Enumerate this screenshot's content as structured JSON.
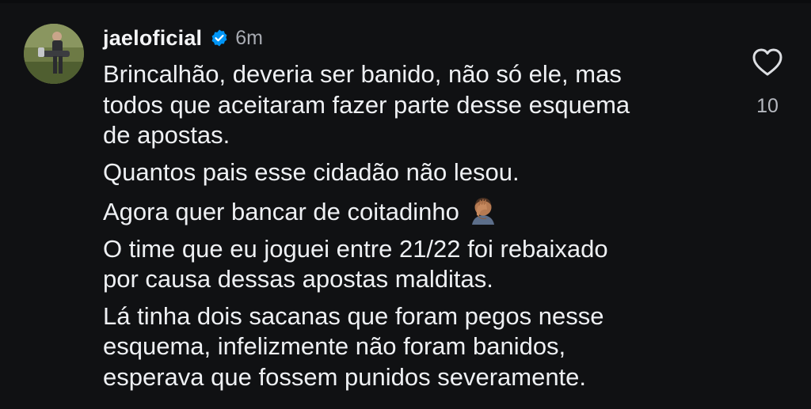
{
  "comment": {
    "username": "jaeloficial",
    "verified_icon": "verified-badge-icon",
    "timestamp": "6m",
    "paragraphs": [
      {
        "lines": [
          "Brincalhão, deveria ser banido, não só ele, mas",
          "todos que aceitaram fazer parte desse esquema",
          "de apostas."
        ]
      },
      {
        "lines": [
          "Quantos pais esse cidadão não lesou."
        ]
      },
      {
        "lines": [
          "Agora quer bancar de coitadinho"
        ],
        "emoji": "facepalm-emoji"
      },
      {
        "lines": [
          "O time que eu joguei entre 21/22 foi rebaixado",
          "por causa dessas apostas malditas."
        ]
      },
      {
        "lines": [
          "Lá tinha dois sacanas que foram pegos nesse",
          "esquema, infelizmente não foram banidos,",
          "esperava que fossem punidos severamente."
        ]
      }
    ],
    "like_icon": "heart-icon",
    "like_count": "10"
  },
  "colors": {
    "background": "#101113",
    "text": "#eef0f3",
    "muted": "#a8abb2",
    "verified_blue": "#0095f6"
  }
}
